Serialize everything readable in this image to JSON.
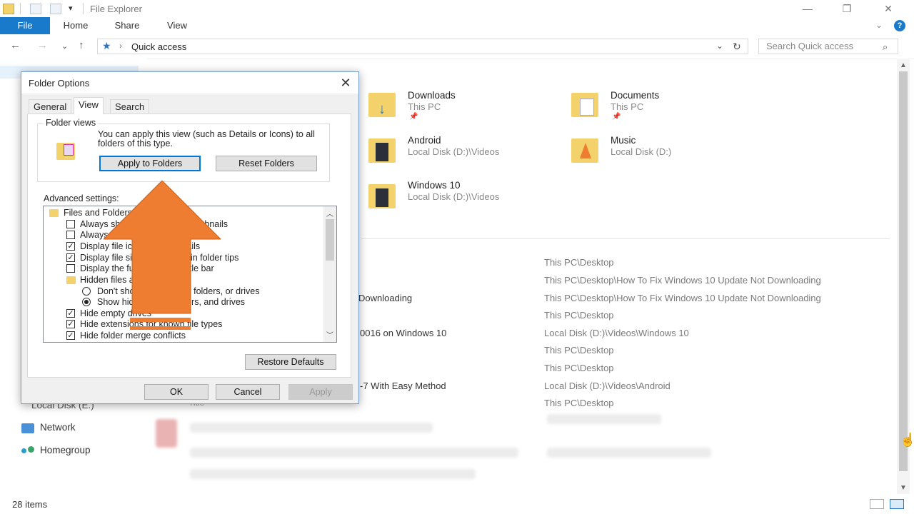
{
  "window": {
    "title": "File Explorer",
    "controls": {
      "minimize": "—",
      "restore": "❐",
      "close": "✕"
    }
  },
  "ribbon": {
    "tabs": [
      {
        "label": "File"
      },
      {
        "label": "Home"
      },
      {
        "label": "Share"
      },
      {
        "label": "View"
      }
    ]
  },
  "address_bar": {
    "location": "Quick access",
    "search_placeholder": "Search Quick access"
  },
  "sidebar": {
    "items": [
      {
        "label": "Local Disk (E:)"
      },
      {
        "label": "Network"
      },
      {
        "label": "Homegroup"
      }
    ]
  },
  "quick_access": {
    "items": [
      {
        "name": "Downloads",
        "location": "This PC",
        "pinned": true
      },
      {
        "name": "Documents",
        "location": "This PC",
        "pinned": true
      },
      {
        "name": "Android",
        "location": "Local Disk (D:)\\Videos"
      },
      {
        "name": "Music",
        "location": "Local Disk (D:)"
      },
      {
        "name": "Windows 10",
        "location": "Local Disk (D:)\\Videos"
      }
    ]
  },
  "recent_files": {
    "names": [
      "Downloading",
      "0016 on Windows 10",
      "-7 With Easy Method",
      "Title"
    ],
    "paths": [
      "This PC\\Desktop",
      "This PC\\Desktop\\How To Fix Windows 10 Update Not Downloading",
      "This PC\\Desktop\\How To Fix Windows 10 Update Not Downloading",
      "This PC\\Desktop",
      "Local Disk (D:)\\Videos\\Windows 10",
      "This PC\\Desktop",
      "This PC\\Desktop",
      "Local Disk (D:)\\Videos\\Android",
      "This PC\\Desktop"
    ]
  },
  "status_bar": {
    "count": "28 items"
  },
  "dialog": {
    "title": "Folder Options",
    "tabs": [
      {
        "label": "General"
      },
      {
        "label": "View"
      },
      {
        "label": "Search"
      }
    ],
    "active_tab": "View",
    "folder_views": {
      "legend": "Folder views",
      "description": "You can apply this view (such as Details or Icons) to all folders of this type.",
      "apply_button": "Apply to Folders",
      "reset_button": "Reset Folders"
    },
    "advanced_label": "Advanced settings:",
    "advanced_items": [
      {
        "label": "Files and Folders",
        "kind": "folder"
      },
      {
        "label": "Always show icons, never thumbnails",
        "kind": "checkbox",
        "checked": false
      },
      {
        "label": "Always show menus",
        "kind": "checkbox",
        "checked": false
      },
      {
        "label": "Display file icon on thumbnails",
        "kind": "checkbox",
        "checked": true
      },
      {
        "label": "Display file size information in folder tips",
        "kind": "checkbox",
        "checked": true
      },
      {
        "label": "Display the full path in the title bar",
        "kind": "checkbox",
        "checked": false
      },
      {
        "label": "Hidden files and folders",
        "kind": "folder"
      },
      {
        "label": "Don't show hidden files, folders, or drives",
        "kind": "radio",
        "checked": false
      },
      {
        "label": "Show hidden files, folders, and drives",
        "kind": "radio",
        "checked": true
      },
      {
        "label": "Hide empty drives",
        "kind": "checkbox",
        "checked": true
      },
      {
        "label": "Hide extensions for known file types",
        "kind": "checkbox",
        "checked": true
      },
      {
        "label": "Hide folder merge conflicts",
        "kind": "checkbox",
        "checked": true
      }
    ],
    "restore_defaults": "Restore Defaults",
    "ok": "OK",
    "cancel": "Cancel",
    "apply": "Apply"
  },
  "colors": {
    "file_tab": "#1979ca",
    "annotation_arrow": "#ef7d31",
    "folder_yellow": "#f3d26b"
  }
}
